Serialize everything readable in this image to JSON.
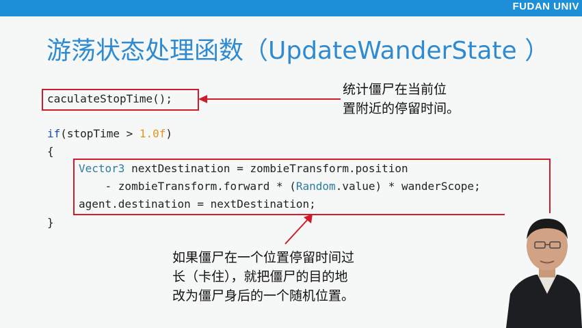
{
  "header": {
    "brand": "FUDAN UNIV"
  },
  "slide": {
    "title": "游荡状态处理函数（UpdateWanderState ）",
    "code": {
      "line1": "caculateStopTime();",
      "line2_kw": "if",
      "line2_a": "(stopTime > ",
      "line2_num": "1.0f",
      "line2_b": ")",
      "line3": "{",
      "line4_type": "Vector3",
      "line4_rest": " nextDestination = zombieTransform.position",
      "line5_a": "    - zombieTransform.forward * (",
      "line5_type": "Random",
      "line5_b": ".value) * wanderScope;",
      "line6": "agent.destination = nextDestination;",
      "line7": "}"
    },
    "note1": {
      "line1": "统计僵尸在当前位",
      "line2": "置附近的停留时间。"
    },
    "note2": {
      "line1": "如果僵尸在一个位置停留时间过",
      "line2": "长（卡住），就把僵尸的目的地",
      "line3": "改为僵尸身后的一个随机位置。"
    }
  },
  "colors": {
    "accent": "#1d8fd6",
    "title": "#2f8bd1",
    "highlight": "#d11a2a"
  }
}
